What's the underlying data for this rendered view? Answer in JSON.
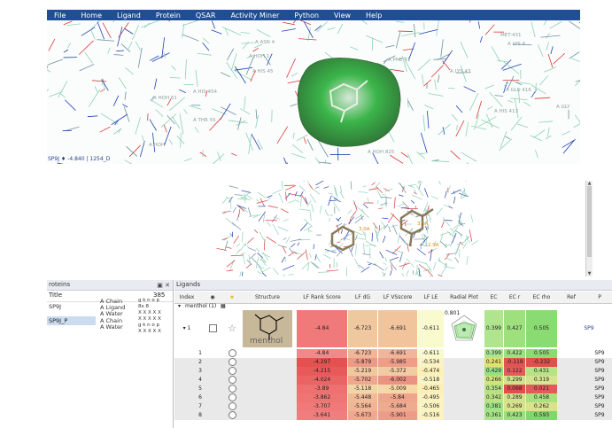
{
  "menu": [
    "File",
    "Home",
    "Ligand",
    "Protein",
    "QSAR",
    "Activity Miner",
    "Python",
    "View",
    "Help"
  ],
  "viewer": {
    "status": "SP9J ♦ -4.840 | 1254_D",
    "labels_top": [
      "A ASN 4",
      "A HOH 1",
      "A HIS 45",
      "A HIS 454",
      "A THR 55",
      "A HOH 61",
      "A PHE 41",
      "A LYS 43",
      "A HOH 825",
      "MET-431",
      "A LYS 4",
      "A GLU 416",
      "A HIS 413",
      "A GLY",
      "A HOH"
    ],
    "labels_bottom": [
      "3.0A",
      "3.1A",
      "2.9A"
    ]
  },
  "proteins_panel": {
    "title": "roteins",
    "col_title": "Title",
    "col_num": "385",
    "items": [
      "SP9J",
      "SP9J_P"
    ],
    "chains": [
      "A Chain",
      "A Ligand",
      "A Water",
      "A Chain",
      "A Water"
    ],
    "seq_lines": [
      "g k n o p",
      "8x 8",
      "X X X X X",
      "X X X X X",
      "g k n o p",
      "X X X X X"
    ]
  },
  "ligands_panel": {
    "title": "Ligands",
    "columns": [
      "Index",
      "",
      "",
      "Structure",
      "LF Rank Score",
      "LF dG",
      "LF VSscore",
      "LF LE",
      "Radial Plot",
      "EC",
      "EC r",
      "EC rho",
      "Ref",
      "P"
    ],
    "group_label": "menthol (1)",
    "structure_caption": "menthol",
    "radial_value": "0.801",
    "main_row": {
      "index": "1",
      "rank": "-4.84",
      "dg": "-6.723",
      "vs": "-6.691",
      "le": "-0.611",
      "ec": "0.399",
      "ecr": "0.427",
      "ecrho": "0.505",
      "ref": "SP9"
    },
    "rows": [
      {
        "index": "1",
        "rank": "-4.84",
        "dg": "-6.723",
        "vs": "-6.691",
        "le": "-0.611",
        "ec": "0.399",
        "ecr": "0.422",
        "ecrho": "0.505",
        "ref": "SP9"
      },
      {
        "index": "2",
        "rank": "-4.297",
        "dg": "-5.879",
        "vs": "-5.985",
        "le": "-0.534",
        "ec": "0.241",
        "ecr": "-0.118",
        "ecrho": "-0.232",
        "ref": "SP9"
      },
      {
        "index": "3",
        "rank": "-4.215",
        "dg": "-5.219",
        "vs": "-5.372",
        "le": "-0.474",
        "ec": "0.429",
        "ecr": "0.122",
        "ecrho": "0.431",
        "ref": "SP9"
      },
      {
        "index": "4",
        "rank": "-4.024",
        "dg": "-5.702",
        "vs": "-6.002",
        "le": "-0.518",
        "ec": "0.266",
        "ecr": "0.299",
        "ecrho": "0.319",
        "ref": "SP9"
      },
      {
        "index": "5",
        "rank": "-3.89",
        "dg": "-5.118",
        "vs": "-5.009",
        "le": "-0.465",
        "ec": "0.354",
        "ecr": "0.068",
        "ecrho": "0.021",
        "ref": "SP9"
      },
      {
        "index": "6",
        "rank": "-3.862",
        "dg": "-5.448",
        "vs": "-5.84",
        "le": "-0.495",
        "ec": "0.342",
        "ecr": "0.289",
        "ecrho": "0.458",
        "ref": "SP9"
      },
      {
        "index": "7",
        "rank": "-3.707",
        "dg": "-5.564",
        "vs": "-5.684",
        "le": "-0.506",
        "ec": "0.381",
        "ecr": "0.269",
        "ecrho": "0.262",
        "ref": "SP9"
      },
      {
        "index": "8",
        "rank": "-3.641",
        "dg": "-5.673",
        "vs": "-5.901",
        "le": "-0.516",
        "ec": "0.361",
        "ecr": "0.423",
        "ecrho": "0.593",
        "ref": "SP9"
      }
    ],
    "colors": {
      "rank_main": "#f07a7a",
      "rank_rows": [
        "#f08a8a",
        "#e55050",
        "#e85a5a",
        "#ea6464",
        "#ee7070",
        "#ef7474",
        "#f07a7a",
        "#f17e7e"
      ],
      "dg_rows": [
        "#f3b59a",
        "#ec9a88",
        "#f0c8a0",
        "#efa890",
        "#f3d4a8",
        "#f2bb98",
        "#f1b495",
        "#f0a890"
      ],
      "vs_rows": [
        "#f3b59a",
        "#ef9c88",
        "#f1cba2",
        "#ec9282",
        "#f6d7a8",
        "#efa48c",
        "#efab90",
        "#ee9c8a"
      ],
      "le_rows": [
        "#fafacf",
        "#fbf3c3",
        "#faf0b8",
        "#fbf3c1",
        "#faefb6",
        "#fbf2bf",
        "#fbf3c2",
        "#fbf3c0"
      ],
      "ec_rows": [
        "#aee58e",
        "#e2e070",
        "#96e082",
        "#cfe57b",
        "#b6e284",
        "#bce285",
        "#9ee385",
        "#a8e387"
      ],
      "ecr_rows": [
        "#9ee07e",
        "#e25454",
        "#e25b5b",
        "#d0e38c",
        "#e24d4d",
        "#d2e38c",
        "#dbe28c",
        "#9ae07d"
      ],
      "ecrho_rows": [
        "#8adc72",
        "#e24e4e",
        "#b6e387",
        "#d6e38f",
        "#e25a5a",
        "#a8e280",
        "#d9e38e",
        "#7dd96c"
      ]
    }
  }
}
